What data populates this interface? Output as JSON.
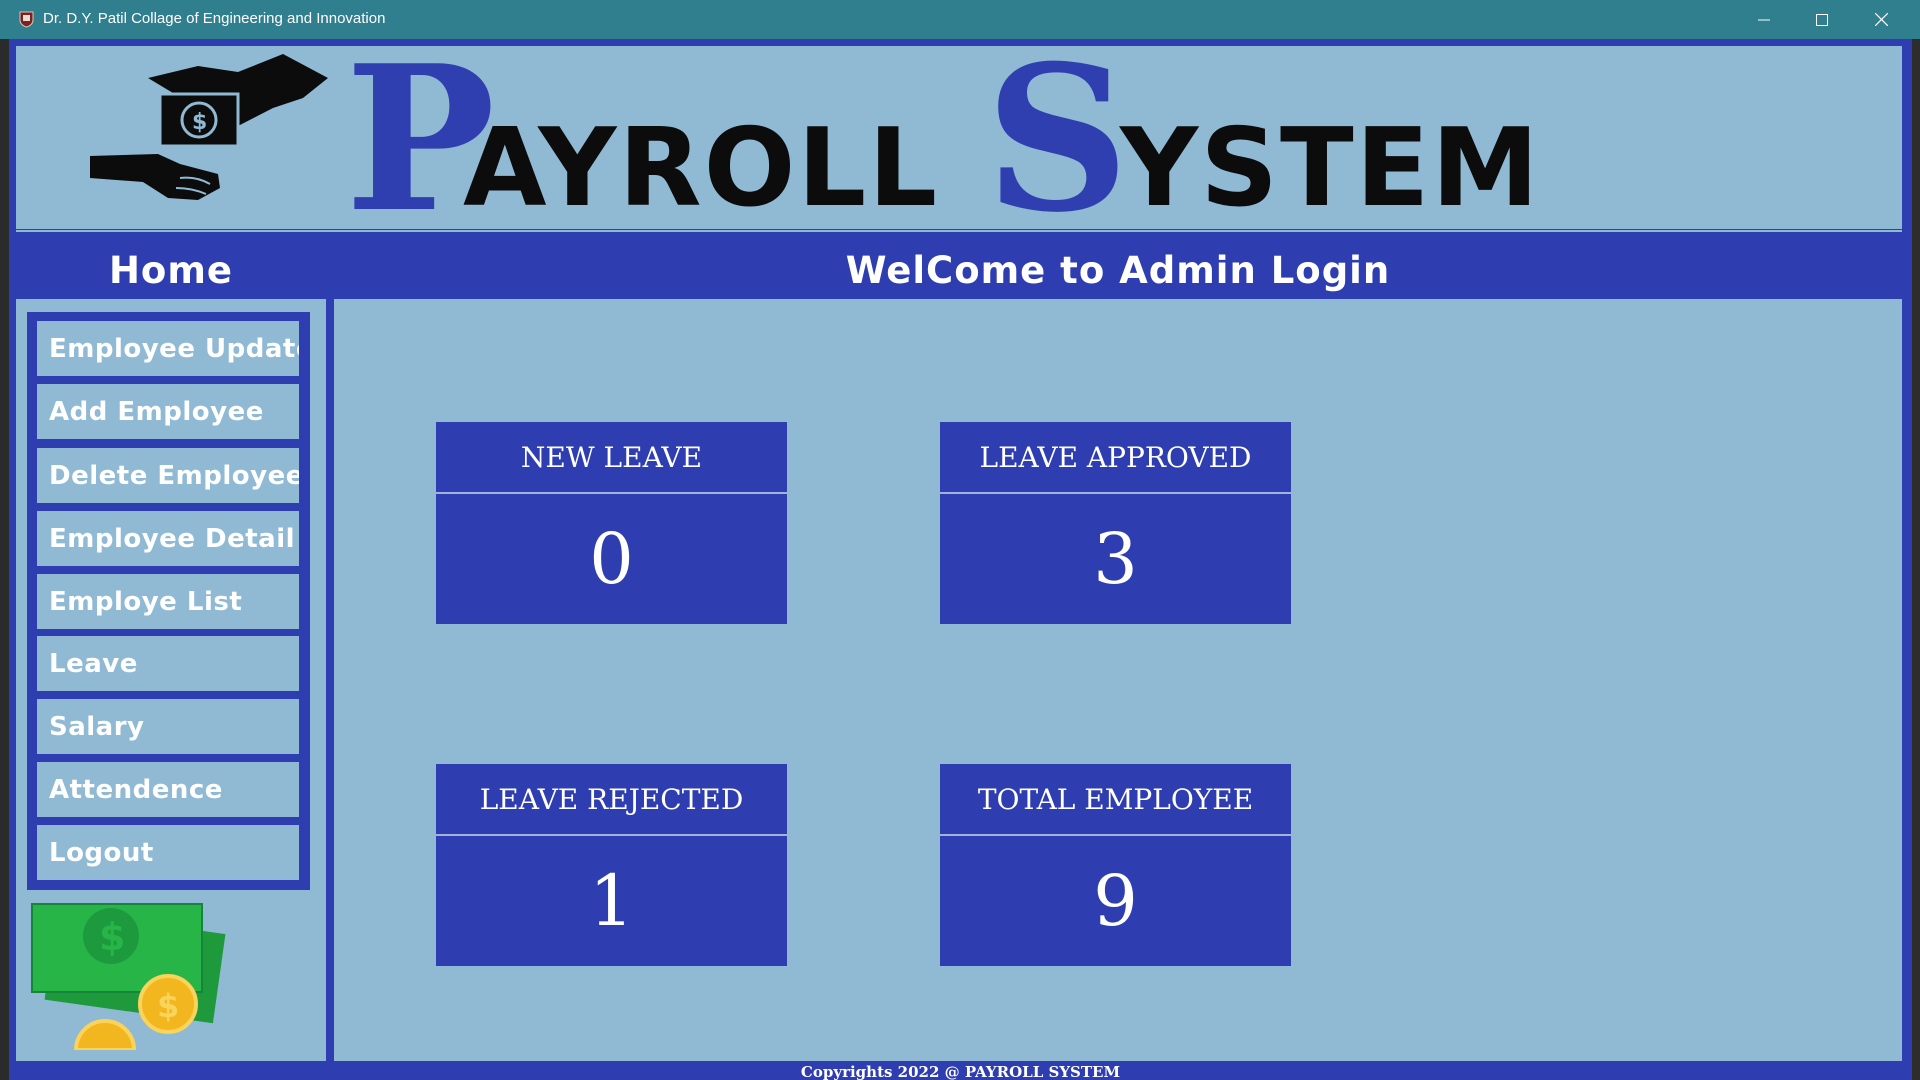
{
  "window": {
    "title": "Dr. D.Y. Patil Collage of Engineering and Innovation"
  },
  "header": {
    "brand_first_initial": "P",
    "brand_first_rest": "AYROLL",
    "brand_second_initial": "S",
    "brand_second_rest": "YSTEM"
  },
  "sidebar": {
    "title": "Home",
    "items": [
      {
        "label": "Employee Update"
      },
      {
        "label": "Add Employee"
      },
      {
        "label": "Delete Employee"
      },
      {
        "label": "Employee Detail"
      },
      {
        "label": "Employe List"
      },
      {
        "label": "Leave"
      },
      {
        "label": "Salary"
      },
      {
        "label": "Attendence"
      },
      {
        "label": "Logout"
      }
    ]
  },
  "main": {
    "title": "WelCome to Admin Login",
    "cards": [
      {
        "label": "NEW LEAVE",
        "value": "0"
      },
      {
        "label": "LEAVE APPROVED",
        "value": "3"
      },
      {
        "label": "LEAVE REJECTED",
        "value": "1"
      },
      {
        "label": "TOTAL EMPLOYEE",
        "value": "9"
      }
    ]
  },
  "footer": {
    "text": "Copyrights 2022 @ PAYROLL SYSTEM"
  },
  "colors": {
    "titlebar": "#2f7f8e",
    "accent_blue": "#2e3db0",
    "panel_bg": "#90bad4",
    "brand_dark": "#0c0c0c"
  }
}
